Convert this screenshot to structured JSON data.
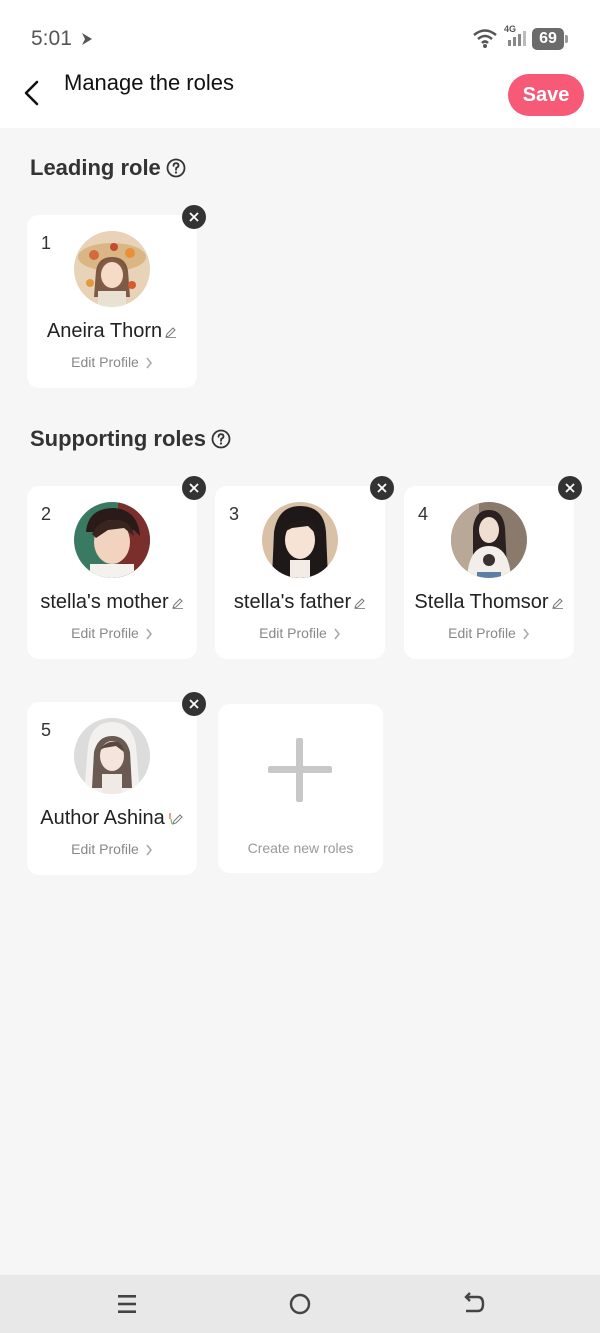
{
  "status": {
    "time": "5:01",
    "network": "4G",
    "battery": "69"
  },
  "header": {
    "title": "Manage the roles",
    "save_label": "Save"
  },
  "sections": {
    "leading": "Leading role",
    "supporting": "Supporting roles"
  },
  "roles": [
    {
      "number": "1",
      "name": "Aneira Thorn",
      "edit": "Edit Profile"
    },
    {
      "number": "2",
      "name": "stella's mother",
      "edit": "Edit Profile"
    },
    {
      "number": "3",
      "name": "stella's father",
      "edit": "Edit Profile"
    },
    {
      "number": "4",
      "name": "Stella Thomsor",
      "edit": "Edit Profile"
    },
    {
      "number": "5",
      "name": "Author Ashina",
      "edit": "Edit Profile"
    }
  ],
  "create": {
    "label": "Create new roles"
  },
  "colors": {
    "accent": "#f65a76",
    "background": "#f6f6f6"
  }
}
